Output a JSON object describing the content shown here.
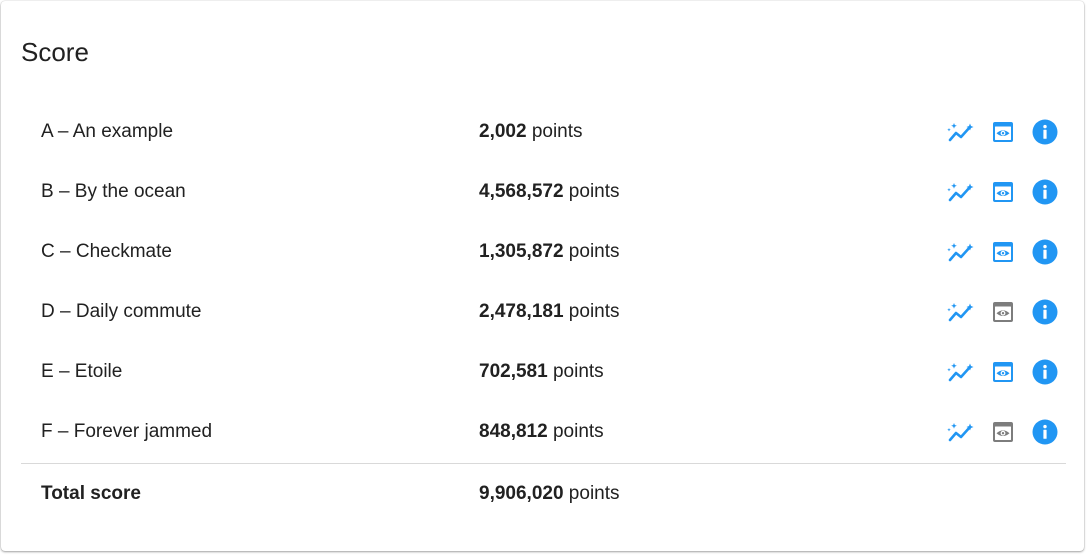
{
  "card": {
    "title": "Score"
  },
  "colors": {
    "accent": "#2196f3",
    "disabled": "#7d7d7d",
    "text": "#212121",
    "divider": "#d9d9d9"
  },
  "icons": {
    "trend": "trend-sparkle-icon",
    "view": "eye-icon",
    "info": "info-icon"
  },
  "rows": [
    {
      "name": "A – An example",
      "points": "2,002",
      "unit": " points",
      "view_enabled": true
    },
    {
      "name": "B – By the ocean",
      "points": "4,568,572",
      "unit": " points",
      "view_enabled": true
    },
    {
      "name": "C – Checkmate",
      "points": "1,305,872",
      "unit": " points",
      "view_enabled": true
    },
    {
      "name": "D – Daily commute",
      "points": "2,478,181",
      "unit": " points",
      "view_enabled": false
    },
    {
      "name": "E – Etoile",
      "points": "702,581",
      "unit": " points",
      "view_enabled": true
    },
    {
      "name": "F – Forever jammed",
      "points": "848,812",
      "unit": " points",
      "view_enabled": false
    }
  ],
  "total": {
    "label": "Total score",
    "points": "9,906,020",
    "unit": " points"
  }
}
